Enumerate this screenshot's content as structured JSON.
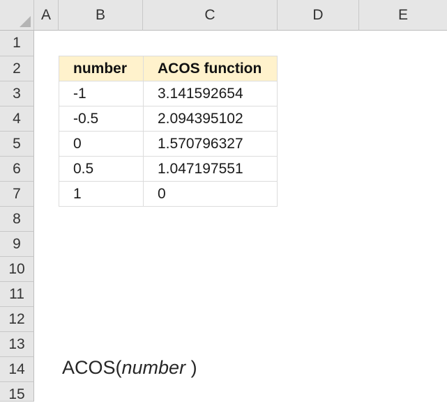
{
  "columns": [
    "A",
    "B",
    "C",
    "D",
    "E"
  ],
  "rows": [
    "1",
    "2",
    "3",
    "4",
    "5",
    "6",
    "7",
    "8",
    "9",
    "10",
    "11",
    "12",
    "13",
    "14",
    "15"
  ],
  "table": {
    "header": [
      "number",
      "ACOS function"
    ],
    "rows": [
      [
        "-1",
        "3.141592654"
      ],
      [
        "-0.5",
        "2.094395102"
      ],
      [
        "0",
        "1.570796327"
      ],
      [
        "0.5",
        "1.047197551"
      ],
      [
        "1",
        "0"
      ]
    ]
  },
  "syntax": {
    "name": "ACOS(",
    "argument": "number",
    "close": " )"
  }
}
